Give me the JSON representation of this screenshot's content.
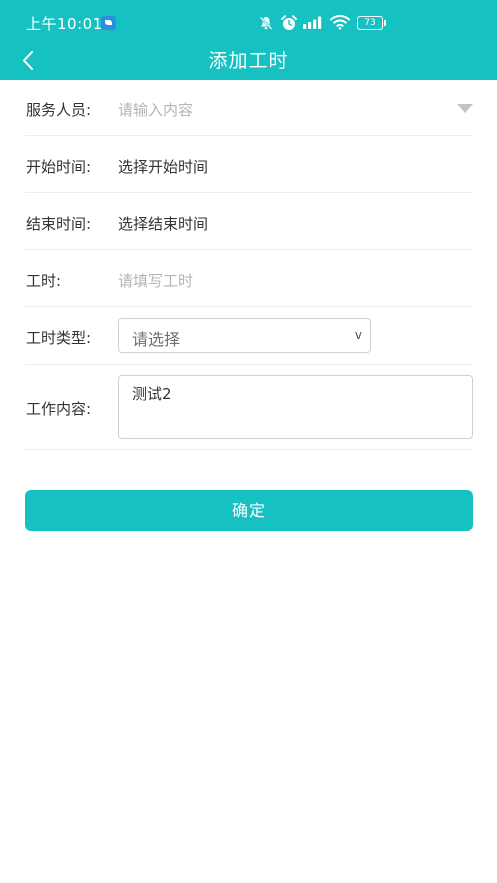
{
  "status_bar": {
    "time": "上午10:01",
    "battery": "73",
    "icons": [
      "app-notification-icon",
      "bell-muted-icon",
      "alarm-icon",
      "signal-icon",
      "wifi-icon",
      "battery-icon"
    ]
  },
  "colors": {
    "accent": "#16c1c2",
    "label_text": "#333333",
    "placeholder_text": "#b4b4b8",
    "divider": "#ececec",
    "border": "#cfcfd4"
  },
  "header": {
    "title": "添加工时",
    "back_icon": "chevron-left-icon"
  },
  "form": {
    "staff": {
      "label": "服务人员:",
      "placeholder": "请输入内容",
      "icon": "triangle-down-icon"
    },
    "start_time": {
      "label": "开始时间:",
      "value": "选择开始时间"
    },
    "end_time": {
      "label": "结束时间:",
      "value": "选择结束时间"
    },
    "hours": {
      "label": "工时:",
      "placeholder": "请填写工时"
    },
    "hour_type": {
      "label": "工时类型:",
      "selected": "请选择",
      "chevron": "v"
    },
    "work_content": {
      "label": "工作内容:",
      "value": "测试2"
    }
  },
  "actions": {
    "confirm_label": "确定"
  }
}
